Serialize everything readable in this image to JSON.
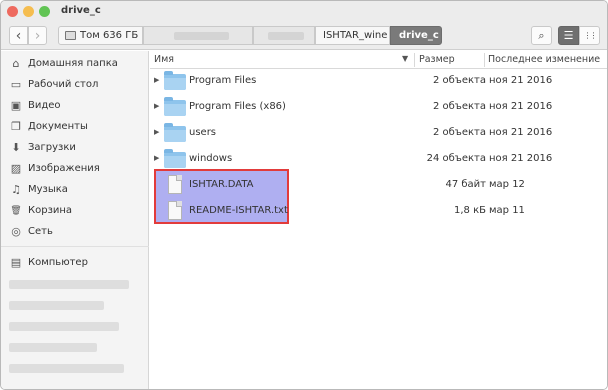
{
  "window": {
    "title": "drive_c"
  },
  "toolbar": {
    "back_icon": "‹",
    "forward_icon": "›",
    "path": [
      {
        "label": "Том 636 ГБ"
      },
      {
        "label": "ISHTAR_wine"
      },
      {
        "label": "drive_c"
      }
    ],
    "search_icon": "⌕",
    "list_view_icon": "☰",
    "grid_view_icon": "⋮⋮"
  },
  "sidebar": {
    "places": [
      {
        "label": "Домашняя папка",
        "icon": "home-icon",
        "glyph": "⌂"
      },
      {
        "label": "Рабочий стол",
        "icon": "desktop-icon",
        "glyph": "▭"
      },
      {
        "label": "Видео",
        "icon": "video-icon",
        "glyph": "▣"
      },
      {
        "label": "Документы",
        "icon": "documents-icon",
        "glyph": "❐"
      },
      {
        "label": "Загрузки",
        "icon": "downloads-icon",
        "glyph": "⬇"
      },
      {
        "label": "Изображения",
        "icon": "images-icon",
        "glyph": "▨"
      },
      {
        "label": "Музыка",
        "icon": "music-icon",
        "glyph": "♫"
      },
      {
        "label": "Корзина",
        "icon": "trash-icon",
        "glyph": "🗑"
      },
      {
        "label": "Сеть",
        "icon": "network-icon",
        "glyph": "◎"
      }
    ],
    "devices": [
      {
        "label": "Компьютер",
        "icon": "computer-icon",
        "glyph": "▤"
      }
    ]
  },
  "columns": {
    "name": "Имя",
    "size": "Размер",
    "modified": "Последнее изменение"
  },
  "files": [
    {
      "name": "Program Files",
      "size": "2 объекта",
      "modified": "ноя 21 2016",
      "kind": "folder"
    },
    {
      "name": "Program Files (x86)",
      "size": "2 объекта",
      "modified": "ноя 21 2016",
      "kind": "folder"
    },
    {
      "name": "users",
      "size": "2 объекта",
      "modified": "ноя 21 2016",
      "kind": "folder"
    },
    {
      "name": "windows",
      "size": "24 объекта",
      "modified": "ноя 21 2016",
      "kind": "folder"
    },
    {
      "name": "ISHTAR.DATA",
      "size": "47 байт",
      "modified": "мар 12",
      "kind": "file"
    },
    {
      "name": "README-ISHTAR.txt",
      "size": "1,8 кБ",
      "modified": "мар 11",
      "kind": "file"
    }
  ],
  "colors": {
    "selection": "#6e6ee6",
    "highlight_border": "#e23b3b",
    "folder": "#8ec4ec"
  }
}
